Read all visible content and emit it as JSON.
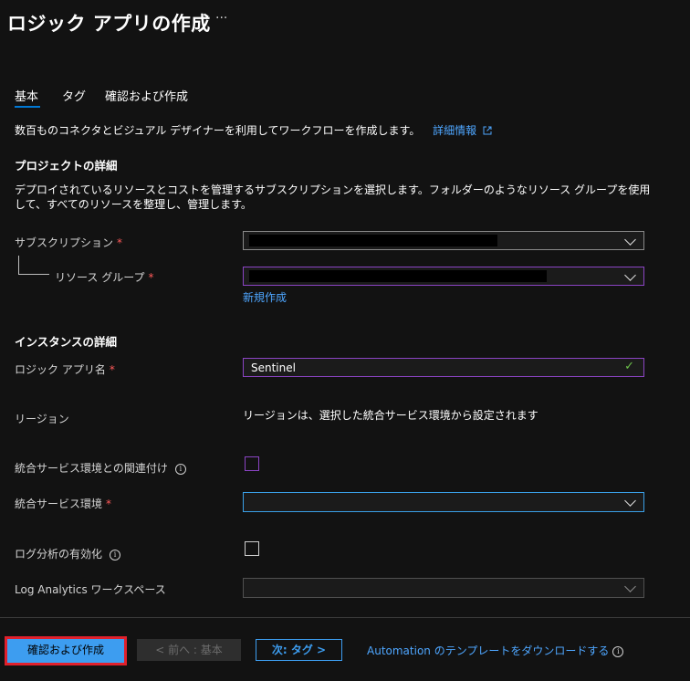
{
  "header": {
    "title": "ロジック アプリの作成",
    "more": "···"
  },
  "tabs": [
    {
      "label": "基本"
    },
    {
      "label": "タグ"
    },
    {
      "label": "確認および作成"
    }
  ],
  "intro": {
    "text": "数百ものコネクタとビジュアル デザイナーを利用してワークフローを作成します。",
    "link": "詳細情報",
    "link_icon": "external-link-icon"
  },
  "project": {
    "heading": "プロジェクトの詳細",
    "description": "デプロイされているリソースとコストを管理するサブスクリプションを選択します。フォルダーのようなリソース グループを使用して、すべてのリソースを整理し、管理します。",
    "subscription_label": "サブスクリプション",
    "resource_group_label": "リソース グループ",
    "new_link": "新規作成",
    "required_mark": "*"
  },
  "instance": {
    "heading": "インスタンスの詳細",
    "app_name_label": "ロジック アプリ名",
    "app_name_value": "Sentinel",
    "region_label": "リージョン",
    "region_value": "リージョンは、選択した統合サービス環境から設定されます",
    "ise_assoc_label": "統合サービス環境との関連付け",
    "ise_label": "統合サービス環境",
    "log_analytics_enable_label": "ログ分析の有効化",
    "workspace_label": "Log Analytics ワークスペース",
    "info_glyph": "i"
  },
  "footer": {
    "review_create": "確認および作成",
    "prev": "< 前へ : 基本",
    "next": "次: タグ >",
    "download": "Automation のテンプレートをダウンロードする"
  },
  "colors": {
    "accent": "#3d9df0",
    "highlight": "#e0202c",
    "purple_border": "#8b44c4",
    "valid": "#6cc04a"
  }
}
